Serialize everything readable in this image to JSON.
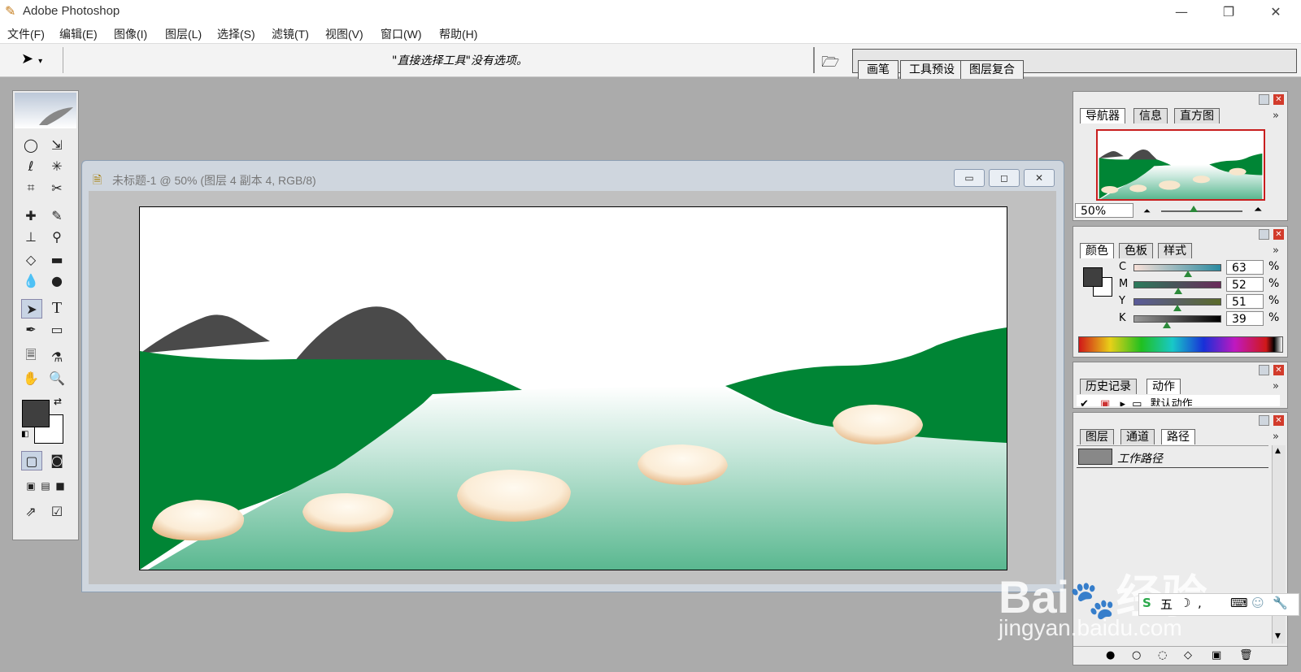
{
  "app": {
    "title": "Adobe Photoshop"
  },
  "window_controls": {
    "minimize": "—",
    "restore": "❐",
    "close": "✕"
  },
  "menu": [
    "文件(F)",
    "编辑(E)",
    "图像(I)",
    "图层(L)",
    "选择(S)",
    "滤镜(T)",
    "视图(V)",
    "窗口(W)",
    "帮助(H)"
  ],
  "options_bar": {
    "message": "\"直接选择工具\"没有选项。",
    "well_tabs": [
      "画笔",
      "工具预设",
      "图层复合"
    ]
  },
  "document": {
    "title": "未标题-1 @ 50% (图层 4 副本 4, RGB/8)"
  },
  "navigator": {
    "tabs": [
      "导航器",
      "信息",
      "直方图"
    ],
    "zoom": "50%"
  },
  "color": {
    "tabs": [
      "颜色",
      "色板",
      "样式"
    ],
    "channels": [
      {
        "label": "C",
        "value": "63",
        "unit": "%",
        "level": 0.63
      },
      {
        "label": "M",
        "value": "52",
        "unit": "%",
        "level": 0.52
      },
      {
        "label": "Y",
        "value": "51",
        "unit": "%",
        "level": 0.51
      },
      {
        "label": "K",
        "value": "39",
        "unit": "%",
        "level": 0.39
      }
    ]
  },
  "history": {
    "tabs": [
      "历史记录",
      "动作"
    ],
    "item": "默认动作"
  },
  "layers": {
    "tabs": [
      "图层",
      "通道",
      "路径"
    ],
    "path_item": "工作路径"
  },
  "colors": {
    "foreground": "#3f3f3f",
    "background": "#ffffff",
    "hill": "#008535",
    "mountain": "#4a4a4a"
  },
  "watermark": {
    "main": "Bai",
    "brand": "经验",
    "url": "jingyan.baidu.com"
  },
  "ime": {
    "label": "五"
  }
}
